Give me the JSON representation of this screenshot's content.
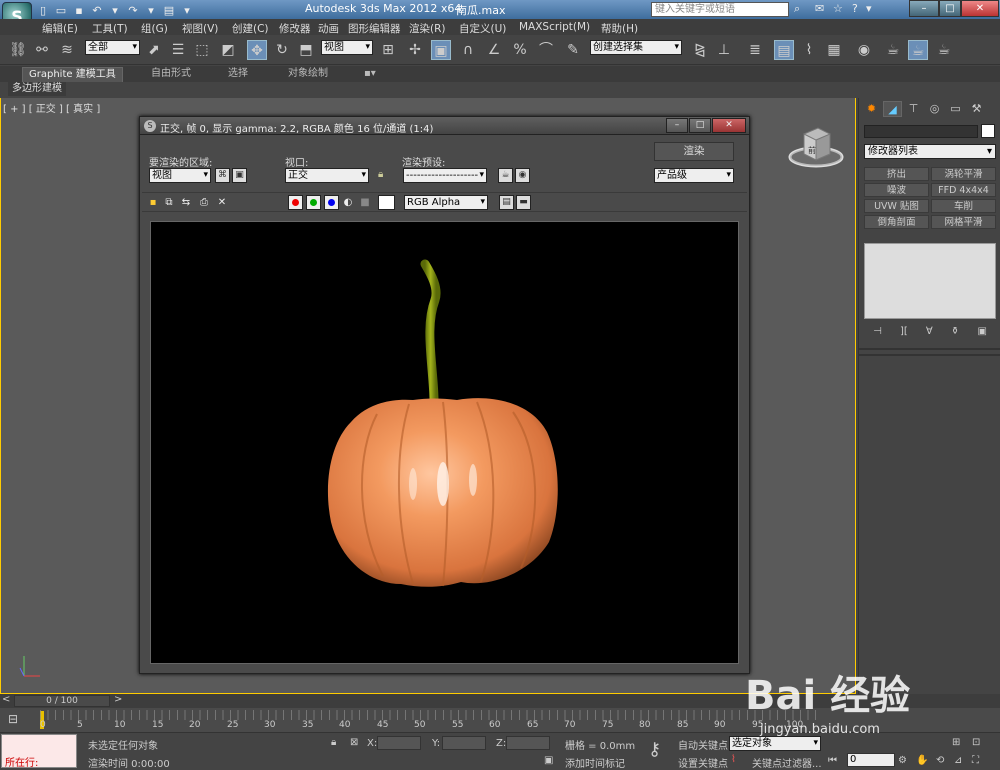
{
  "app": {
    "title": "Autodesk 3ds Max  2012 x64",
    "filename": "南瓜.max",
    "search_placeholder": "键入关键字或短语",
    "logo_letter": "S"
  },
  "window_buttons": {
    "minimize": "–",
    "maximize": "□",
    "close": "✕"
  },
  "menu": [
    "编辑(E)",
    "工具(T)",
    "组(G)",
    "视图(V)",
    "创建(C)",
    "修改器",
    "动画",
    "图形编辑器",
    "渲染(R)",
    "自定义(U)",
    "MAXScript(M)",
    "帮助(H)"
  ],
  "toolbar": {
    "filter": "全部",
    "refcoord": "视图",
    "named_sel": "创建选择集"
  },
  "ribbon": {
    "tabs": [
      "Graphite 建模工具",
      "自由形式",
      "选择",
      "对象绘制"
    ],
    "subtab": "多边形建模"
  },
  "viewport": {
    "label": "[ + ] [ 正交 ] [ 真实 ]",
    "cube_label": "前"
  },
  "render_window": {
    "title": "正交, 帧 0, 显示 gamma: 2.2, RGBA 颜色 16 位/通道 (1:4)",
    "area_label": "要渲染的区域:",
    "area_value": "视图",
    "viewport_label": "视口:",
    "viewport_value": "正交",
    "preset_label": "渲染预设:",
    "preset_value": "--------------------",
    "render_button": "渲染",
    "quality_value": "产品级",
    "channel_value": "RGB Alpha"
  },
  "command_panel": {
    "modifier_list": "修改器列表",
    "buttons": [
      "挤出",
      "涡轮平滑",
      "噪波",
      "FFD 4x4x4",
      "UVW 贴图",
      "车削",
      "倒角剖面",
      "网格平滑"
    ]
  },
  "timeline": {
    "frame": "0 / 100"
  },
  "ticks": [
    "0",
    "5",
    "10",
    "15",
    "20",
    "25",
    "30",
    "35",
    "40",
    "45",
    "50",
    "55",
    "60",
    "65",
    "70",
    "75",
    "80",
    "85",
    "90",
    "95",
    "100"
  ],
  "status": {
    "maxscript": "所在行:",
    "selection": "未选定任何对象",
    "render_time": "渲染时间  0:00:00",
    "x_label": "X:",
    "y_label": "Y:",
    "z_label": "Z:",
    "grid": "栅格 = 0.0mm",
    "add_time_tag": "添加时间标记",
    "auto_key": "自动关键点",
    "set_key": "设置关键点",
    "selected": "选定对象",
    "key_filters": "关键点过滤器...",
    "frame_field": "0"
  },
  "watermark": {
    "text": "Bai  经验",
    "url": "jingyan.baidu.com"
  },
  "colors": {
    "pumpkin": "#f0935a",
    "stem": "#8a9a12",
    "viewport_border": "#ffcc00",
    "accent": "#6b8fb7"
  }
}
